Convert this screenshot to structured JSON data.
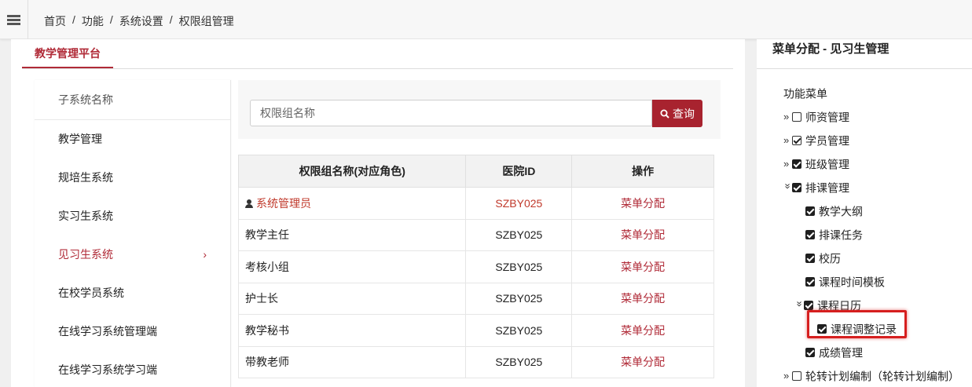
{
  "breadcrumb": [
    "首页",
    "功能",
    "系统设置",
    "权限组管理"
  ],
  "breadcrumb_sep": "/",
  "platform_tab": "教学管理平台",
  "subsystems": {
    "header": "子系统名称",
    "items": [
      "教学管理",
      "规培生系统",
      "实习生系统",
      "见习生系统",
      "在校学员系统",
      "在线学习系统管理端",
      "在线学习系统学习端"
    ],
    "active": "见习生系统",
    "chevron": "›"
  },
  "search": {
    "placeholder": "权限组名称",
    "button_label": "查询"
  },
  "table": {
    "headers": [
      "权限组名称(对应角色)",
      "医院ID",
      "操作"
    ],
    "rows": [
      {
        "name": "系统管理员",
        "id": "SZBY025",
        "op": "菜单分配"
      },
      {
        "name": "教学主任",
        "id": "SZBY025",
        "op": "菜单分配"
      },
      {
        "name": "考核小组",
        "id": "SZBY025",
        "op": "菜单分配"
      },
      {
        "name": "护士长",
        "id": "SZBY025",
        "op": "菜单分配"
      },
      {
        "name": "教学秘书",
        "id": "SZBY025",
        "op": "菜单分配"
      },
      {
        "name": "带教老师",
        "id": "SZBY025",
        "op": "菜单分配"
      }
    ]
  },
  "right_panel": {
    "title": "菜单分配 - 见习生管理",
    "root": "功能菜单",
    "tree": [
      {
        "label": "师资管理",
        "arrow": "»",
        "state": "unchecked"
      },
      {
        "label": "学员管理",
        "arrow": "»",
        "state": "outline-checked"
      },
      {
        "label": "班级管理",
        "arrow": "»",
        "state": "checked"
      },
      {
        "label": "排课管理",
        "arrow": "»",
        "state": "checked",
        "expanded": true
      },
      {
        "label": "教学大纲",
        "state": "checked"
      },
      {
        "label": "排课任务",
        "state": "checked"
      },
      {
        "label": "校历",
        "state": "checked"
      },
      {
        "label": "课程时间模板",
        "state": "checked"
      },
      {
        "label": "课程日历",
        "arrow": "»",
        "state": "checked",
        "expanded": true
      },
      {
        "label": "课程调整记录",
        "state": "checked",
        "highlighted": true
      },
      {
        "label": "成绩管理",
        "state": "checked"
      },
      {
        "label": "轮转计划编制（轮转计划编制）",
        "arrow": "»",
        "state": "unchecked"
      }
    ]
  },
  "colors": {
    "accent": "#b02a37",
    "search_button": "#a8232f",
    "highlight_border": "#d61f1f"
  }
}
